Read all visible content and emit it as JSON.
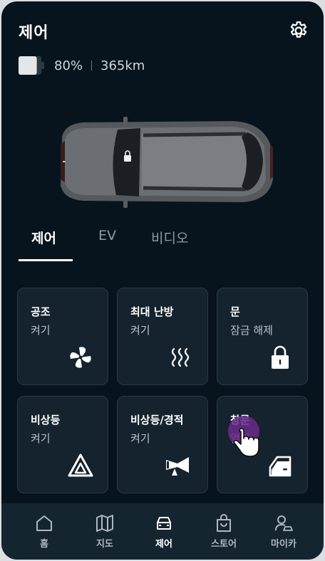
{
  "header": {
    "title": "제어"
  },
  "battery": {
    "percent": "80%",
    "range": "365km",
    "level": 0.8
  },
  "tabs": [
    {
      "label": "제어",
      "active": true
    },
    {
      "label": "EV",
      "active": false
    },
    {
      "label": "비디오",
      "active": false
    }
  ],
  "cards": [
    {
      "title": "공조",
      "sub": "켜기",
      "icon": "fan-icon"
    },
    {
      "title": "최대 난방",
      "sub": "켜기",
      "icon": "heat-icon"
    },
    {
      "title": "문",
      "sub": "잠금 해제",
      "icon": "lock-icon"
    },
    {
      "title": "비상등",
      "sub": "켜기",
      "icon": "hazard-icon"
    },
    {
      "title": "비상등/경적",
      "sub": "켜기",
      "icon": "horn-icon"
    },
    {
      "title": "창문",
      "sub": "열기",
      "icon": "window-icon"
    }
  ],
  "nav": [
    {
      "label": "홈",
      "icon": "home-icon"
    },
    {
      "label": "지도",
      "icon": "map-icon"
    },
    {
      "label": "제어",
      "icon": "car-icon",
      "active": true
    },
    {
      "label": "스토어",
      "icon": "store-icon"
    },
    {
      "label": "마이카",
      "icon": "mycar-icon"
    }
  ],
  "colors": {
    "background": "#07141d",
    "card": "#14232e",
    "nav": "#152530",
    "tap_highlight": "#6a2a8a"
  }
}
